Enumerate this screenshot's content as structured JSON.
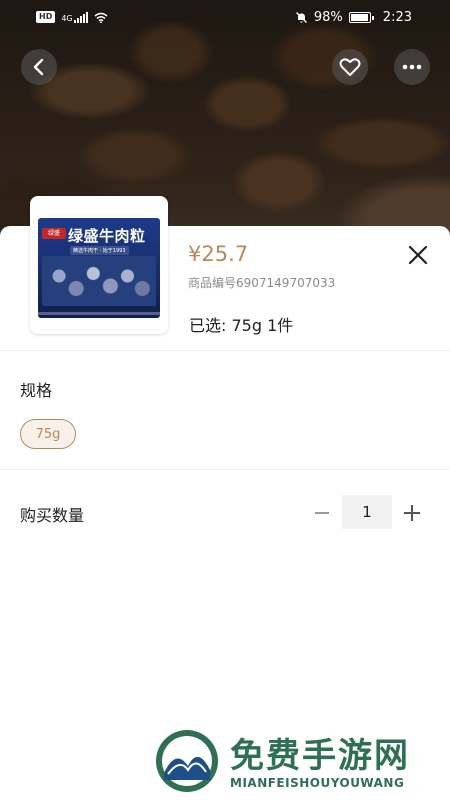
{
  "status_bar": {
    "hd_label": "HD",
    "network_label": "4G",
    "battery_text": "98%",
    "time": "2:23"
  },
  "nav": {
    "back_icon": "chevron-left-icon",
    "favorite_icon": "heart-outline-icon",
    "more_icon": "more-horizontal-icon"
  },
  "product": {
    "package_brand": "绿盛",
    "package_title": "绿盛牛肉粒",
    "package_subtitle": "精选牛肉干 · 始于1993",
    "price": "¥25.7",
    "sku": "商品编号6907149707033",
    "selected_summary": "已选:  75g  1件"
  },
  "spec": {
    "title": "规格",
    "options": [
      "75g"
    ],
    "selected_option": "75g"
  },
  "quantity": {
    "label": "购买数量",
    "value": "1",
    "minus_symbol": "−",
    "plus_symbol": "+"
  },
  "watermark": {
    "title": "免费手游网",
    "subtitle": "MIANFEISHOUYOUWANG"
  },
  "colors": {
    "accent": "#b9895a",
    "watermark": "#2f6f54"
  }
}
